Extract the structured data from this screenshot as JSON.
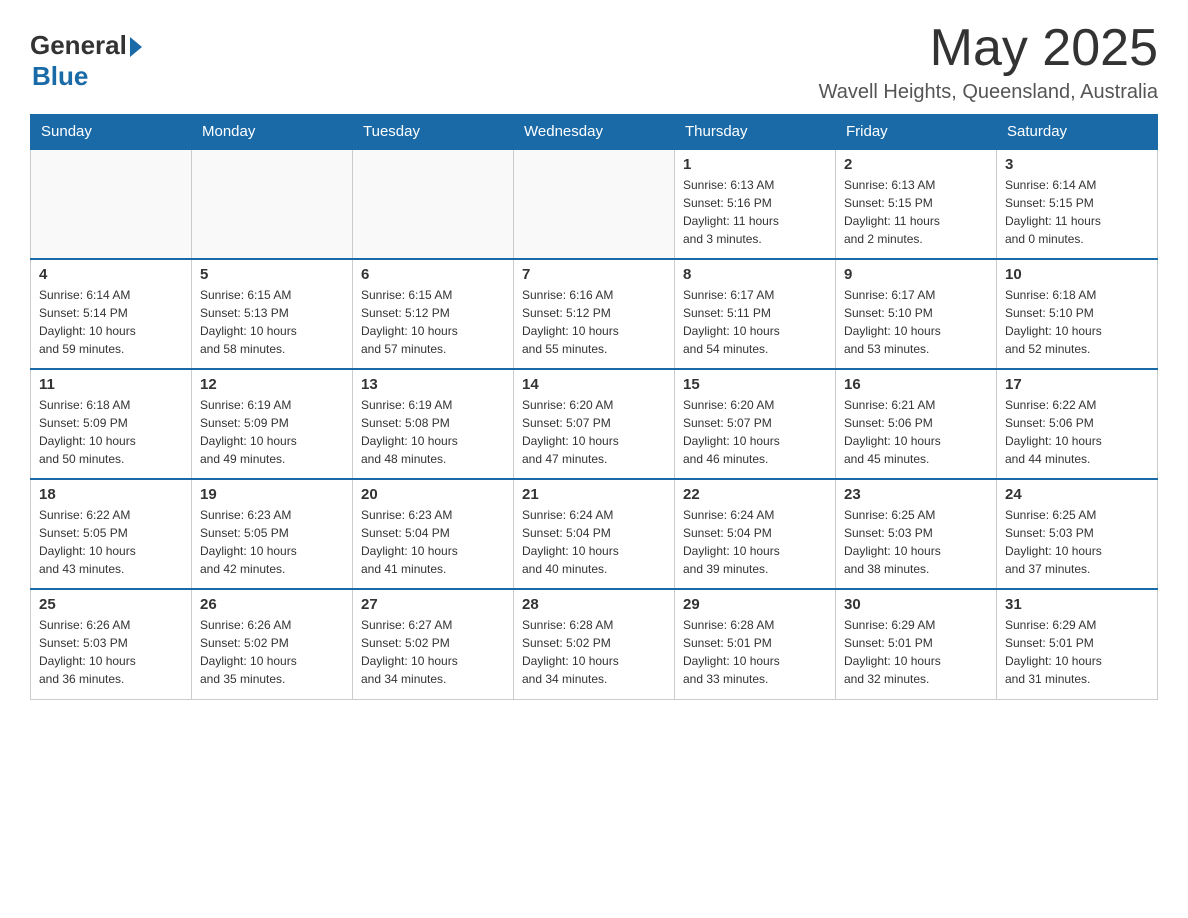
{
  "header": {
    "logo_general": "General",
    "logo_blue": "Blue",
    "logo_sub": "Blue",
    "month_title": "May 2025",
    "location": "Wavell Heights, Queensland, Australia"
  },
  "days_of_week": [
    "Sunday",
    "Monday",
    "Tuesday",
    "Wednesday",
    "Thursday",
    "Friday",
    "Saturday"
  ],
  "weeks": [
    [
      {
        "day": "",
        "info": ""
      },
      {
        "day": "",
        "info": ""
      },
      {
        "day": "",
        "info": ""
      },
      {
        "day": "",
        "info": ""
      },
      {
        "day": "1",
        "info": "Sunrise: 6:13 AM\nSunset: 5:16 PM\nDaylight: 11 hours\nand 3 minutes."
      },
      {
        "day": "2",
        "info": "Sunrise: 6:13 AM\nSunset: 5:15 PM\nDaylight: 11 hours\nand 2 minutes."
      },
      {
        "day": "3",
        "info": "Sunrise: 6:14 AM\nSunset: 5:15 PM\nDaylight: 11 hours\nand 0 minutes."
      }
    ],
    [
      {
        "day": "4",
        "info": "Sunrise: 6:14 AM\nSunset: 5:14 PM\nDaylight: 10 hours\nand 59 minutes."
      },
      {
        "day": "5",
        "info": "Sunrise: 6:15 AM\nSunset: 5:13 PM\nDaylight: 10 hours\nand 58 minutes."
      },
      {
        "day": "6",
        "info": "Sunrise: 6:15 AM\nSunset: 5:12 PM\nDaylight: 10 hours\nand 57 minutes."
      },
      {
        "day": "7",
        "info": "Sunrise: 6:16 AM\nSunset: 5:12 PM\nDaylight: 10 hours\nand 55 minutes."
      },
      {
        "day": "8",
        "info": "Sunrise: 6:17 AM\nSunset: 5:11 PM\nDaylight: 10 hours\nand 54 minutes."
      },
      {
        "day": "9",
        "info": "Sunrise: 6:17 AM\nSunset: 5:10 PM\nDaylight: 10 hours\nand 53 minutes."
      },
      {
        "day": "10",
        "info": "Sunrise: 6:18 AM\nSunset: 5:10 PM\nDaylight: 10 hours\nand 52 minutes."
      }
    ],
    [
      {
        "day": "11",
        "info": "Sunrise: 6:18 AM\nSunset: 5:09 PM\nDaylight: 10 hours\nand 50 minutes."
      },
      {
        "day": "12",
        "info": "Sunrise: 6:19 AM\nSunset: 5:09 PM\nDaylight: 10 hours\nand 49 minutes."
      },
      {
        "day": "13",
        "info": "Sunrise: 6:19 AM\nSunset: 5:08 PM\nDaylight: 10 hours\nand 48 minutes."
      },
      {
        "day": "14",
        "info": "Sunrise: 6:20 AM\nSunset: 5:07 PM\nDaylight: 10 hours\nand 47 minutes."
      },
      {
        "day": "15",
        "info": "Sunrise: 6:20 AM\nSunset: 5:07 PM\nDaylight: 10 hours\nand 46 minutes."
      },
      {
        "day": "16",
        "info": "Sunrise: 6:21 AM\nSunset: 5:06 PM\nDaylight: 10 hours\nand 45 minutes."
      },
      {
        "day": "17",
        "info": "Sunrise: 6:22 AM\nSunset: 5:06 PM\nDaylight: 10 hours\nand 44 minutes."
      }
    ],
    [
      {
        "day": "18",
        "info": "Sunrise: 6:22 AM\nSunset: 5:05 PM\nDaylight: 10 hours\nand 43 minutes."
      },
      {
        "day": "19",
        "info": "Sunrise: 6:23 AM\nSunset: 5:05 PM\nDaylight: 10 hours\nand 42 minutes."
      },
      {
        "day": "20",
        "info": "Sunrise: 6:23 AM\nSunset: 5:04 PM\nDaylight: 10 hours\nand 41 minutes."
      },
      {
        "day": "21",
        "info": "Sunrise: 6:24 AM\nSunset: 5:04 PM\nDaylight: 10 hours\nand 40 minutes."
      },
      {
        "day": "22",
        "info": "Sunrise: 6:24 AM\nSunset: 5:04 PM\nDaylight: 10 hours\nand 39 minutes."
      },
      {
        "day": "23",
        "info": "Sunrise: 6:25 AM\nSunset: 5:03 PM\nDaylight: 10 hours\nand 38 minutes."
      },
      {
        "day": "24",
        "info": "Sunrise: 6:25 AM\nSunset: 5:03 PM\nDaylight: 10 hours\nand 37 minutes."
      }
    ],
    [
      {
        "day": "25",
        "info": "Sunrise: 6:26 AM\nSunset: 5:03 PM\nDaylight: 10 hours\nand 36 minutes."
      },
      {
        "day": "26",
        "info": "Sunrise: 6:26 AM\nSunset: 5:02 PM\nDaylight: 10 hours\nand 35 minutes."
      },
      {
        "day": "27",
        "info": "Sunrise: 6:27 AM\nSunset: 5:02 PM\nDaylight: 10 hours\nand 34 minutes."
      },
      {
        "day": "28",
        "info": "Sunrise: 6:28 AM\nSunset: 5:02 PM\nDaylight: 10 hours\nand 34 minutes."
      },
      {
        "day": "29",
        "info": "Sunrise: 6:28 AM\nSunset: 5:01 PM\nDaylight: 10 hours\nand 33 minutes."
      },
      {
        "day": "30",
        "info": "Sunrise: 6:29 AM\nSunset: 5:01 PM\nDaylight: 10 hours\nand 32 minutes."
      },
      {
        "day": "31",
        "info": "Sunrise: 6:29 AM\nSunset: 5:01 PM\nDaylight: 10 hours\nand 31 minutes."
      }
    ]
  ]
}
